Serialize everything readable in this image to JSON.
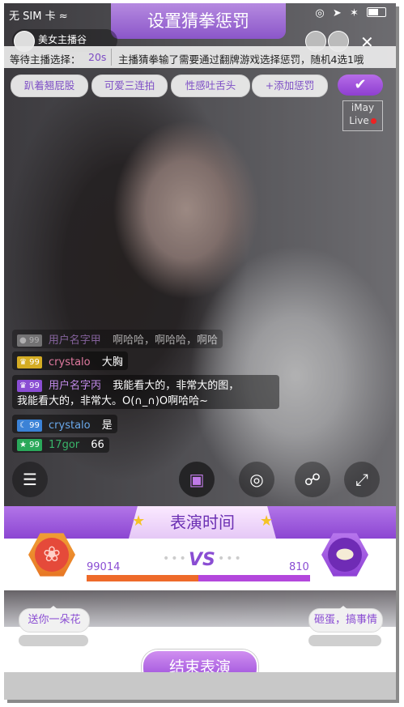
{
  "status": {
    "carrier": "无 SIM 卡",
    "wifi_icon": "wifi-icon",
    "right_icons": [
      "orientation-lock-icon",
      "location-icon",
      "bluetooth-icon",
      "battery-icon"
    ]
  },
  "title": "设置猜拳惩罚",
  "anchor": {
    "name": "美女主播谷"
  },
  "wait": {
    "label": "等待主播选择：",
    "seconds": "20s",
    "message": "主播猜拳输了需要通过翻牌游戏选择惩罚，随机4选1哦"
  },
  "penalties": [
    "趴着翘屁股",
    "可爱三连拍",
    "性感吐舌头",
    "+添加惩罚"
  ],
  "confirm_icon": "check-icon",
  "watermark": {
    "line1": "iMay",
    "line2": "Live"
  },
  "chat": [
    {
      "level": "99",
      "name": "用户名字甲",
      "text": "啊哈哈，啊哈哈，啊哈",
      "badge_color": "#9b9b9b"
    },
    {
      "level": "99",
      "name": "crystalo",
      "text": "大胸",
      "badge_color": "#d4ac23"
    },
    {
      "level": "99",
      "name": "用户名字丙",
      "text": "我能看大的，非常大的图，",
      "text2": "我能看大的，非常大。O(∩_∩)O啊哈哈~",
      "badge_color": "#8a4dd3"
    },
    {
      "level": "99",
      "name": "crystalo",
      "text": "是",
      "badge_color": "#3b82d6"
    },
    {
      "level": "99",
      "name": "17gor",
      "text": "66",
      "badge_color": "#2aa85a"
    }
  ],
  "bottom_icons": [
    "chat-icon",
    "gift-icon",
    "gamepad-icon",
    "share-icon",
    "fullscreen-icon"
  ],
  "performance": {
    "title": "表演时间",
    "left_score": "99014",
    "right_score": "810",
    "vs": "VS",
    "left_fraction": 0.5,
    "left_bubble": "送你一朵花",
    "right_bubble": "砸蛋，搞事情",
    "end_button": "结束表演"
  }
}
